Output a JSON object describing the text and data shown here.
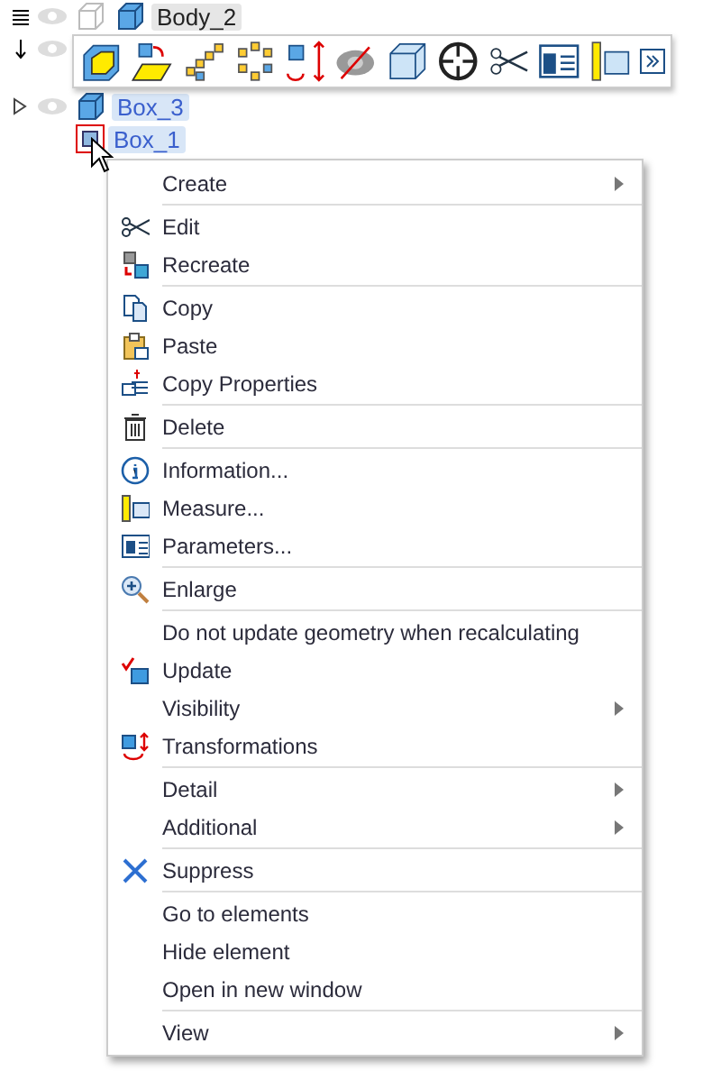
{
  "tree": [
    {
      "kind": "menu",
      "label": "Body_2",
      "selected": false
    },
    {
      "kind": "arrow"
    },
    {
      "kind": "triangle",
      "label": "Box_3",
      "selected": true
    },
    {
      "kind": "none",
      "label": "Box_1",
      "selected": true
    }
  ],
  "context_menu": [
    [
      {
        "label": "Create",
        "submenu": true,
        "icon": false
      }
    ],
    [
      {
        "label": "Edit",
        "submenu": false,
        "icon": true
      },
      {
        "label": "Recreate",
        "submenu": false,
        "icon": true
      }
    ],
    [
      {
        "label": "Copy",
        "submenu": false,
        "icon": true
      },
      {
        "label": "Paste",
        "submenu": false,
        "icon": true
      },
      {
        "label": "Copy Properties",
        "submenu": false,
        "icon": true
      }
    ],
    [
      {
        "label": "Delete",
        "submenu": false,
        "icon": true
      }
    ],
    [
      {
        "label": "Information...",
        "submenu": false,
        "icon": true
      },
      {
        "label": "Measure...",
        "submenu": false,
        "icon": true
      },
      {
        "label": "Parameters...",
        "submenu": false,
        "icon": true
      }
    ],
    [
      {
        "label": "Enlarge",
        "submenu": false,
        "icon": true
      }
    ],
    [
      {
        "label": "Do not update geometry when recalculating",
        "submenu": false,
        "icon": false
      },
      {
        "label": "Update",
        "submenu": false,
        "icon": true
      },
      {
        "label": "Visibility",
        "submenu": true,
        "icon": false
      },
      {
        "label": "Transformations",
        "submenu": false,
        "icon": true
      }
    ],
    [
      {
        "label": "Detail",
        "submenu": true,
        "icon": false
      },
      {
        "label": "Additional",
        "submenu": true,
        "icon": false
      }
    ],
    [
      {
        "label": "Suppress",
        "submenu": false,
        "icon": true
      }
    ],
    [
      {
        "label": "Go to elements",
        "submenu": false,
        "icon": false
      },
      {
        "label": "Hide element",
        "submenu": false,
        "icon": false
      },
      {
        "label": "Open in new window",
        "submenu": false,
        "icon": false
      }
    ],
    [
      {
        "label": "View",
        "submenu": true,
        "icon": false
      }
    ]
  ]
}
